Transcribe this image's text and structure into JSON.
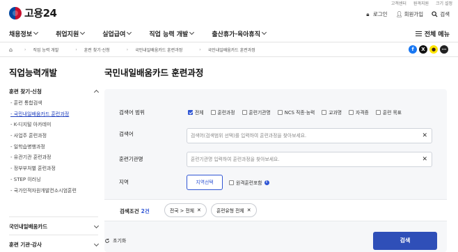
{
  "header": {
    "logo_text": "고용24",
    "util_links": [
      "고객센터",
      "원격지원",
      "크기 설정"
    ],
    "login_label": "로그인",
    "signup_label": "회원가입",
    "search_label": "검색"
  },
  "gnb": {
    "items": [
      "채용정보",
      "취업지원",
      "실업급여",
      "직업 능력 개발",
      "출산휴가·육아휴직"
    ],
    "all_menu_label": "전체 메뉴"
  },
  "breadcrumb": {
    "items": [
      "직업 능력 개발",
      "훈련 찾기·신청",
      "국민내일배움카드 훈련과정",
      "국민내일배움카드 훈련과정"
    ]
  },
  "share": {
    "colors": {
      "facebook": "#1877f2",
      "x": "#111111",
      "kakao": "#fee500",
      "link": "#222222"
    }
  },
  "sidebar": {
    "title": "직업능력개발",
    "section1": {
      "title": "훈련 찾기·신청",
      "items": [
        "- 훈련 통합검색",
        "- 국민내일배움카드 훈련과정",
        "- K-디지털 아카데미",
        "- 사업주 훈련과정",
        "- 일학습병행과정",
        "- 유관기관 훈련과정",
        "- 정부부처별 훈련과정",
        "- STEP 이러닝",
        "- 국가인적자원개발컨소시엄훈련"
      ],
      "active_index": 1
    },
    "section2": {
      "title": "국민내일배움카드"
    },
    "section3": {
      "title": "훈련 기관·강사"
    }
  },
  "main": {
    "title": "국민내일배움카드 훈련과정",
    "search_scope_label": "검색어 범위",
    "scope_options": [
      {
        "label": "전체",
        "checked": true
      },
      {
        "label": "훈련과정",
        "checked": false
      },
      {
        "label": "훈련기관명",
        "checked": false
      },
      {
        "label": "NCS 직종·능력",
        "checked": false
      },
      {
        "label": "교과명",
        "checked": false
      },
      {
        "label": "자격증",
        "checked": false
      },
      {
        "label": "훈련 목표",
        "checked": false
      }
    ],
    "keyword_label": "검색어",
    "keyword_placeholder": "검색어(검색범위 선택)를 입력하여 훈련과정을 찾아보세요.",
    "institution_label": "훈련기관명",
    "institution_placeholder": "훈련기관명 입력하여 훈련과정을 찾아보세요.",
    "region_label": "지역",
    "region_button": "지역선택",
    "remote_label": "원격훈련포함",
    "conditions_label": "검색조건",
    "conditions_count": "2건",
    "chips": [
      "전국 > 전체",
      "훈련유형 전체"
    ],
    "reset_label": "초기화",
    "search_button": "검색"
  }
}
